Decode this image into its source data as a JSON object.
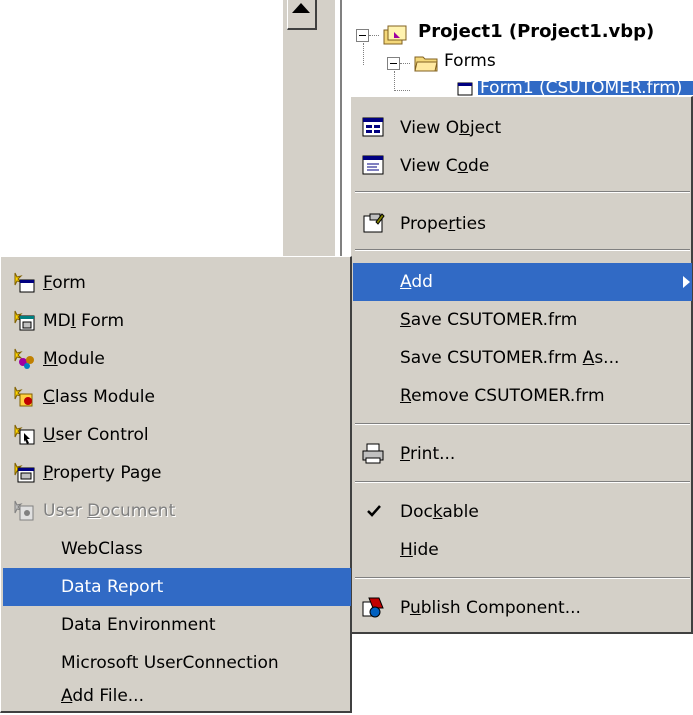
{
  "tree": {
    "project": "Project1 (Project1.vbp)",
    "forms_folder": "Forms",
    "form_item": "Form1 (CSUTOMER.frm)"
  },
  "context_menu": {
    "view_object": {
      "pre": "View O",
      "acc": "b",
      "post": "ject"
    },
    "view_code": {
      "pre": "View C",
      "acc": "o",
      "post": "de"
    },
    "properties": {
      "pre": "Prope",
      "acc": "r",
      "post": "ties"
    },
    "add": {
      "pre": "",
      "acc": "A",
      "post": "dd"
    },
    "save": {
      "pre": "",
      "acc": "S",
      "post": "ave CSUTOMER.frm"
    },
    "save_as": {
      "pre": "Save CSUTOMER.frm ",
      "acc": "A",
      "post": "s..."
    },
    "remove": {
      "pre": "",
      "acc": "R",
      "post": "emove CSUTOMER.frm"
    },
    "print": {
      "pre": "",
      "acc": "P",
      "post": "rint..."
    },
    "dockable": {
      "pre": "Doc",
      "acc": "k",
      "post": "able"
    },
    "hide": {
      "pre": "",
      "acc": "H",
      "post": "ide"
    },
    "publish": {
      "pre": "P",
      "acc": "u",
      "post": "blish Component..."
    }
  },
  "add_submenu": {
    "form": {
      "pre": "",
      "acc": "F",
      "post": "orm"
    },
    "mdi_form": {
      "pre": "MD",
      "acc": "I",
      "post": " Form"
    },
    "module": {
      "pre": "",
      "acc": "M",
      "post": "odule"
    },
    "class_module": {
      "pre": "",
      "acc": "C",
      "post": "lass Module"
    },
    "user_control": {
      "pre": "",
      "acc": "U",
      "post": "ser Control"
    },
    "property_page": {
      "pre": "",
      "acc": "P",
      "post": "roperty Page"
    },
    "user_document": {
      "pre": "User ",
      "acc": "D",
      "post": "ocument"
    },
    "webclass": "WebClass",
    "data_report": "Data Report",
    "data_environment": "Data Environment",
    "user_connection": "Microsoft UserConnection",
    "add_file": {
      "pre": "",
      "acc": "A",
      "post": "dd File..."
    }
  },
  "colors": {
    "menu_bg": "#d4d0c8",
    "highlight": "#316ac5",
    "highlight_text": "#ffffff"
  }
}
